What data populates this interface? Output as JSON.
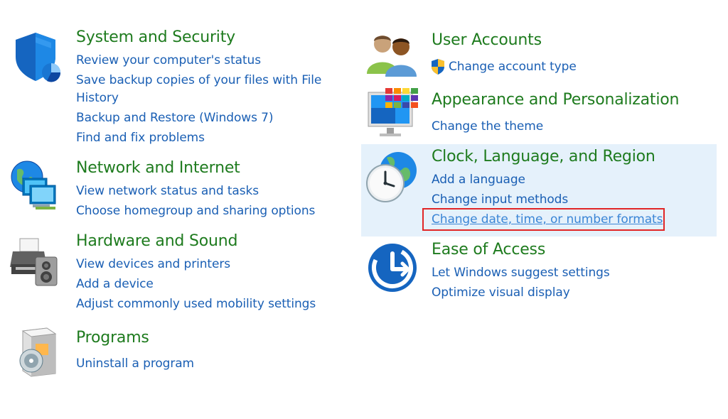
{
  "categories": {
    "system_security": {
      "title": "System and Security",
      "links": [
        "Review your computer's status",
        "Save backup copies of your files with File",
        "History",
        "Backup and Restore (Windows 7)",
        "Find and fix problems"
      ]
    },
    "network_internet": {
      "title": "Network and Internet",
      "links": [
        "View network status and tasks",
        "Choose homegroup and sharing options"
      ]
    },
    "hardware_sound": {
      "title": "Hardware and Sound",
      "links": [
        "View devices and printers",
        "Add a device",
        "Adjust commonly used mobility settings"
      ]
    },
    "programs": {
      "title": "Programs",
      "links": [
        "Uninstall a program"
      ]
    },
    "user_accounts": {
      "title": "User Accounts",
      "links": [
        "Change account type"
      ]
    },
    "appearance": {
      "title": "Appearance and Personalization",
      "links": [
        "Change the theme"
      ]
    },
    "clock_language": {
      "title": "Clock, Language, and Region",
      "links": [
        "Add a language",
        "Change input methods",
        "Change date, time, or number formats"
      ]
    },
    "ease_of_access": {
      "title": "Ease of Access",
      "links": [
        "Let Windows suggest settings",
        "Optimize visual display"
      ]
    }
  },
  "colors": {
    "title_green": "#1e7b1e",
    "link_blue": "#1a5fb4",
    "hover_background": "#e5f1fb",
    "highlight_border": "#e12626"
  },
  "icons": {
    "system_security": "shield-icon",
    "network_internet": "network-monitors-icon",
    "hardware_sound": "printer-speaker-icon",
    "programs": "software-box-icon",
    "user_accounts": "users-icon",
    "uac": "uac-shield-icon",
    "appearance": "monitor-palette-icon",
    "clock_language": "clock-globe-icon",
    "ease_of_access": "accessibility-icon"
  }
}
